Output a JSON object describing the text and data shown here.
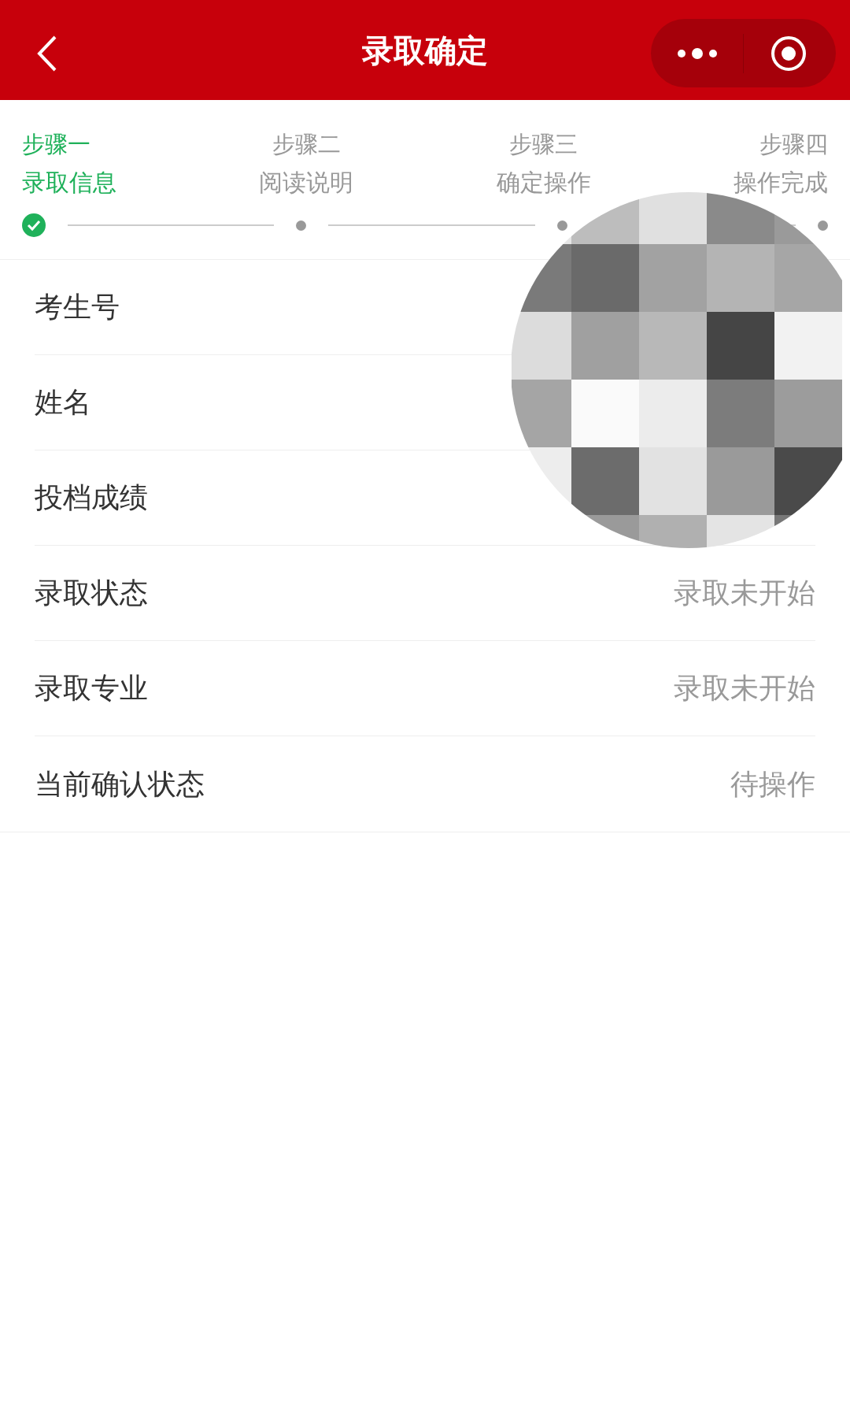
{
  "header": {
    "title": "录取确定"
  },
  "steps": [
    {
      "step": "步骤一",
      "label": "录取信息",
      "selected": true
    },
    {
      "step": "步骤二",
      "label": "阅读说明",
      "selected": false
    },
    {
      "step": "步骤三",
      "label": "确定操作",
      "selected": false
    },
    {
      "step": "步骤四",
      "label": "操作完成",
      "selected": false
    }
  ],
  "rows": [
    {
      "label": "考生号"
    },
    {
      "label": "姓名"
    },
    {
      "label": "投档成绩"
    },
    {
      "label": "录取状态",
      "value": "录取未开始"
    },
    {
      "label": "录取专业",
      "value": "录取未开始"
    },
    {
      "label": "当前确认状态",
      "value": "待操作"
    }
  ]
}
